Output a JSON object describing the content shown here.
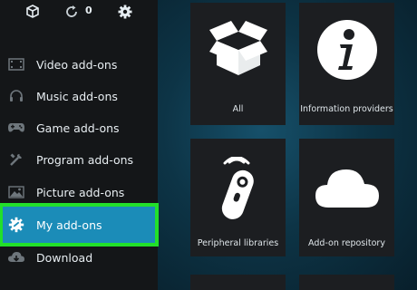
{
  "topbar": {
    "count": "0",
    "icons": [
      "dropbox-icon",
      "refresh-icon",
      "gear-icon"
    ]
  },
  "sidebar": {
    "items": [
      {
        "label": "Video add-ons",
        "icon": "film-icon"
      },
      {
        "label": "Music add-ons",
        "icon": "headphones-icon"
      },
      {
        "label": "Game add-ons",
        "icon": "gamepad-icon"
      },
      {
        "label": "Program add-ons",
        "icon": "tools-icon"
      },
      {
        "label": "Picture add-ons",
        "icon": "picture-icon"
      },
      {
        "label": "My add-ons",
        "icon": "puzzle-gear-icon",
        "active": true
      },
      {
        "label": "Download",
        "icon": "cloud-download-icon"
      }
    ]
  },
  "tiles": [
    {
      "label": "All",
      "icon": "open-box-icon"
    },
    {
      "label": "Information providers",
      "icon": "info-icon"
    },
    {
      "label": "Peripheral libraries",
      "icon": "remote-icon"
    },
    {
      "label": "Add-on repository",
      "icon": "cloud-icon"
    }
  ],
  "colors": {
    "sidebar_bg": "#141618",
    "active_bg": "#1b8cb8",
    "highlight_outline": "#22e02a",
    "tile_bg": "#1c1e21",
    "main_bg": "#0d3446"
  }
}
